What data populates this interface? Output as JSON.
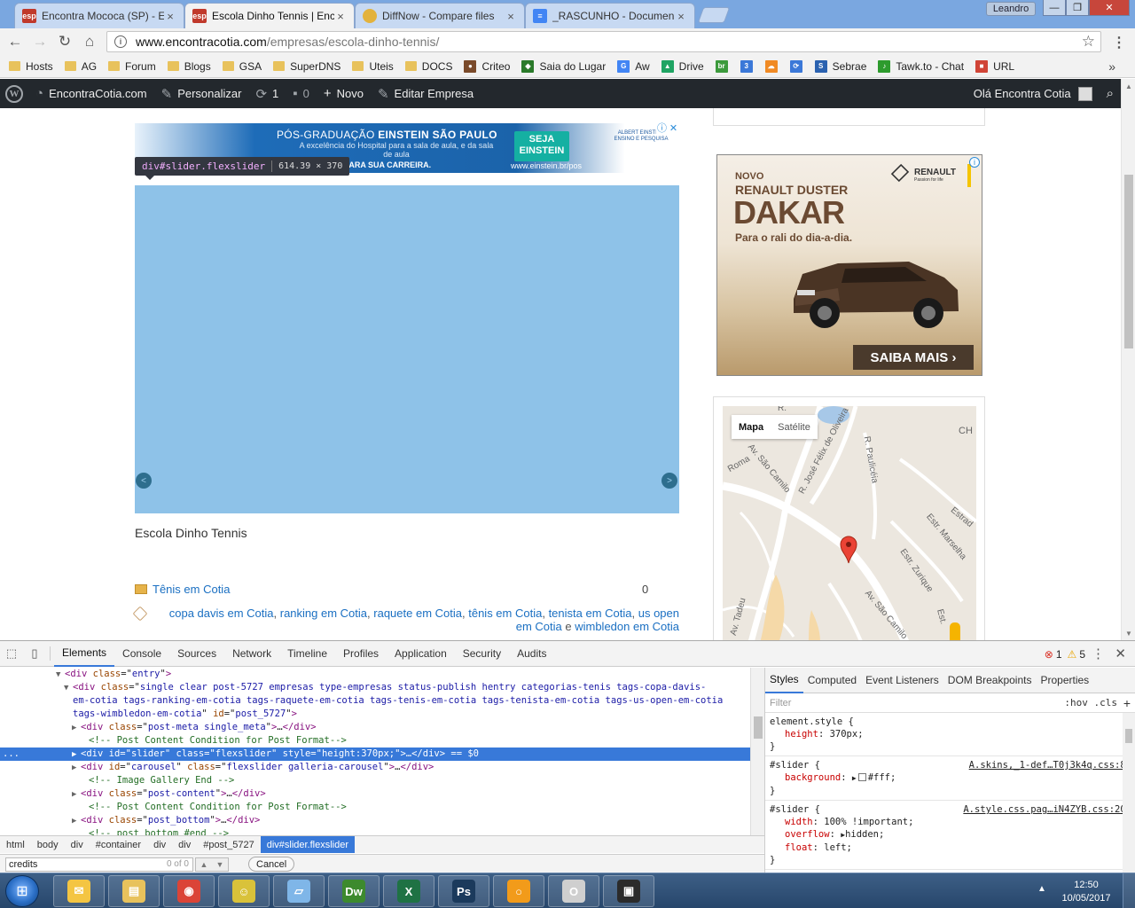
{
  "browser": {
    "tabs": [
      {
        "title": "Encontra Mococa (SP) - E",
        "favicon": "esp",
        "favicon_color": "#c0392b"
      },
      {
        "title": "Escola Dinho Tennis | Enc",
        "favicon": "esp",
        "favicon_color": "#c0392b"
      },
      {
        "title": "DiffNow - Compare files",
        "favicon": "lemon",
        "favicon_color": "#e3b23c"
      },
      {
        "title": "_RASCUNHO - Documen",
        "favicon": "docs",
        "favicon_color": "#4285f4"
      }
    ],
    "active_tab_index": 1,
    "window_user": "Leandro",
    "url_host": "www.encontracotia.com",
    "url_path": "/empresas/escola-dinho-tennis/",
    "bookmarks": [
      {
        "label": "Hosts",
        "icon": "folder"
      },
      {
        "label": "AG",
        "icon": "folder"
      },
      {
        "label": "Forum",
        "icon": "folder"
      },
      {
        "label": "Blogs",
        "icon": "folder"
      },
      {
        "label": "GSA",
        "icon": "folder"
      },
      {
        "label": "SuperDNS",
        "icon": "folder"
      },
      {
        "label": "Uteis",
        "icon": "folder"
      },
      {
        "label": "DOCS",
        "icon": "folder"
      },
      {
        "label": "Criteo",
        "icon": "criteo"
      },
      {
        "label": "Saia do Lugar",
        "icon": "pin"
      },
      {
        "label": "Aw",
        "icon": "google"
      },
      {
        "label": "Drive",
        "icon": "drive"
      },
      {
        "label": "",
        "icon": "br"
      },
      {
        "label": "",
        "icon": "calendar-3"
      },
      {
        "label": "",
        "icon": "cloud"
      },
      {
        "label": "",
        "icon": "sync"
      },
      {
        "label": "Sebrae",
        "icon": "sebrae"
      },
      {
        "label": "Tawk.to - Chat",
        "icon": "tawk"
      },
      {
        "label": "URL",
        "icon": "url"
      }
    ],
    "bookmarks_more": "»"
  },
  "wp_admin_bar": {
    "site_name": "EncontraCotia.com",
    "customize": "Personalizar",
    "updates_count": "1",
    "comments_count": "0",
    "new": "Novo",
    "edit": "Editar Empresa",
    "greeting": "Olá Encontra Cotia"
  },
  "page": {
    "ad_top": {
      "line1_prefix": "PÓS-GRADUAÇÃO ",
      "line1_strong": "EINSTEIN SÃO PAULO",
      "line2": "A excelência do Hospital para a sala de aula, e da sala de aula",
      "line3": "PARA SUA CARREIRA.",
      "cta": "SEJA EINSTEIN",
      "url": "www.einstein.br/pos",
      "brand": "ALBERT EINSTEIN ENSINO E PESQUISA"
    },
    "inspect_tooltip": {
      "tag": "div",
      "selector": "#slider.flexslider",
      "dims": "614.39 × 370"
    },
    "slider_prev": "<",
    "slider_next": ">",
    "caption": "Escola Dinho Tennis",
    "category": "Tênis em Cotia",
    "comment_count": "0",
    "tags": [
      "copa davis em Cotia",
      "ranking em Cotia",
      "raquete em Cotia",
      "tênis em Cotia",
      "tenista em Cotia",
      "us open em Cotia",
      "wimbledon em Cotia"
    ],
    "tags_sep": ", ",
    "tags_last_sep": " e ",
    "ad_side": {
      "novo": "NOVO",
      "model": "RENAULT DUSTER",
      "edition": "DAKAR",
      "tagline": "Para o rali do dia-a-dia.",
      "brand": "RENAULT",
      "brand_sub": "Passion for life",
      "cta": "SAIBA MAIS ›"
    },
    "map": {
      "tab_map": "Mapa",
      "tab_satellite": "Satélite",
      "streets": [
        "Av. São Camilo",
        "R. José Félix de Oliveira",
        "R. Paulicéia",
        "Estr. Marselha",
        "Estr. Zurique",
        "Av. São Camilo",
        "Roma",
        "Estrad",
        "CH",
        "Av. Tadeu",
        "Est.",
        "R."
      ]
    }
  },
  "devtools": {
    "tabs": [
      "Elements",
      "Console",
      "Sources",
      "Network",
      "Timeline",
      "Profiles",
      "Application",
      "Security",
      "Audits"
    ],
    "active_tab": "Elements",
    "errors": "1",
    "warnings": "5",
    "dom_lines": [
      {
        "indent": 7,
        "tri": "▼",
        "html": "<span class=\"t\">&lt;div</span> <span class=\"an\">class</span>=\"<span class=\"av\">entry</span>\"<span class=\"t\">&gt;</span>"
      },
      {
        "indent": 8,
        "tri": "▼",
        "html": "<span class=\"t\">&lt;div</span> <span class=\"an\">class</span>=\"<span class=\"av\">single clear post-5727 empresas type-empresas status-publish hentry categorias-tenis tags-copa-davis-</span>"
      },
      {
        "indent": 8,
        "tri": "",
        "html": "<span class=\"av\">em-cotia tags-ranking-em-cotia tags-raquete-em-cotia tags-tenis-em-cotia tags-tenista-em-cotia tags-us-open-em-cotia</span>"
      },
      {
        "indent": 8,
        "tri": "",
        "html": "<span class=\"av\">tags-wimbledon-em-cotia</span>\" <span class=\"an\">id</span>=\"<span class=\"av\">post_5727</span>\"<span class=\"t\">&gt;</span>"
      },
      {
        "indent": 9,
        "tri": "▶",
        "html": "<span class=\"t\">&lt;div</span> <span class=\"an\">class</span>=\"<span class=\"av\">post-meta single_meta</span>\"<span class=\"t\">&gt;</span>…<span class=\"t\">&lt;/div&gt;</span>"
      },
      {
        "indent": 10,
        "tri": "",
        "html": "<span class=\"cm\">&lt;!--  Post Content Condition for Post Format--&gt;</span>"
      },
      {
        "indent": 9,
        "tri": "▶",
        "html": "<span class=\"t\">&lt;div</span> <span class=\"an\">id</span>=\"<span class=\"av\">slider</span>\" <span class=\"an\">class</span>=\"<span class=\"av\">flexslider</span>\" <span class=\"an\">style</span>=\"<span class=\"av\">height:370px;</span>\"<span class=\"t\">&gt;</span>…<span class=\"t\">&lt;/div&gt;</span> == $0",
        "selected": true
      },
      {
        "indent": 9,
        "tri": "▶",
        "html": "<span class=\"t\">&lt;div</span> <span class=\"an\">id</span>=\"<span class=\"av\">carousel</span>\" <span class=\"an\">class</span>=\"<span class=\"av\">flexslider galleria-carousel</span>\"<span class=\"t\">&gt;</span>…<span class=\"t\">&lt;/div&gt;</span>"
      },
      {
        "indent": 10,
        "tri": "",
        "html": "<span class=\"cm\">&lt;!-- Image Gallery End --&gt;</span>"
      },
      {
        "indent": 9,
        "tri": "▶",
        "html": "<span class=\"t\">&lt;div</span> <span class=\"an\">class</span>=\"<span class=\"av\">post-content</span>\"<span class=\"t\">&gt;</span>…<span class=\"t\">&lt;/div&gt;</span>"
      },
      {
        "indent": 10,
        "tri": "",
        "html": "<span class=\"cm\">&lt;!--  Post Content Condition for Post Format--&gt;</span>"
      },
      {
        "indent": 9,
        "tri": "▶",
        "html": "<span class=\"t\">&lt;div</span> <span class=\"an\">class</span>=\"<span class=\"av\">post_bottom</span>\"<span class=\"t\">&gt;</span>…<span class=\"t\">&lt;/div&gt;</span>"
      },
      {
        "indent": 10,
        "tri": "",
        "html": "<span class=\"cm\">&lt;!-- post_bottom #end --&gt;</span>"
      }
    ],
    "selected_marker": "...",
    "breadcrumbs": [
      "html",
      "body",
      "div",
      "#container",
      "div",
      "div",
      "#post_5727",
      "div#slider.flexslider"
    ],
    "search_value": "credits",
    "search_count": "0 of 0",
    "cancel": "Cancel",
    "styles_tabs": [
      "Styles",
      "Computed",
      "Event Listeners",
      "DOM Breakpoints",
      "Properties"
    ],
    "filter_placeholder": "Filter",
    "filter_opts": ":hov  .cls",
    "rules": [
      {
        "selector": "element.style {",
        "source": "",
        "props": [
          {
            "name": "height",
            "value": "370px;"
          }
        ]
      },
      {
        "selector": "#slider {",
        "source": "A.skins,_1-def…T0j3k4q.css:80",
        "props": [
          {
            "name": "background",
            "value": "#fff;",
            "swatch": true
          }
        ]
      },
      {
        "selector": "#slider {",
        "source": "A.style.css.pag…iN4ZYB.css:203",
        "props": [
          {
            "name": "width",
            "value": "100% !important;"
          },
          {
            "name": "overflow",
            "value": "hidden;",
            "expand": true
          },
          {
            "name": "float",
            "value": "left;"
          }
        ]
      }
    ]
  },
  "taskbar": {
    "apps": [
      "outlook",
      "explorer",
      "chrome",
      "app-yellow",
      "notepad",
      "Dw",
      "excel",
      "Ps",
      "origin",
      "opera",
      "terminal"
    ],
    "time": "12:50",
    "date": "10/05/2017"
  }
}
